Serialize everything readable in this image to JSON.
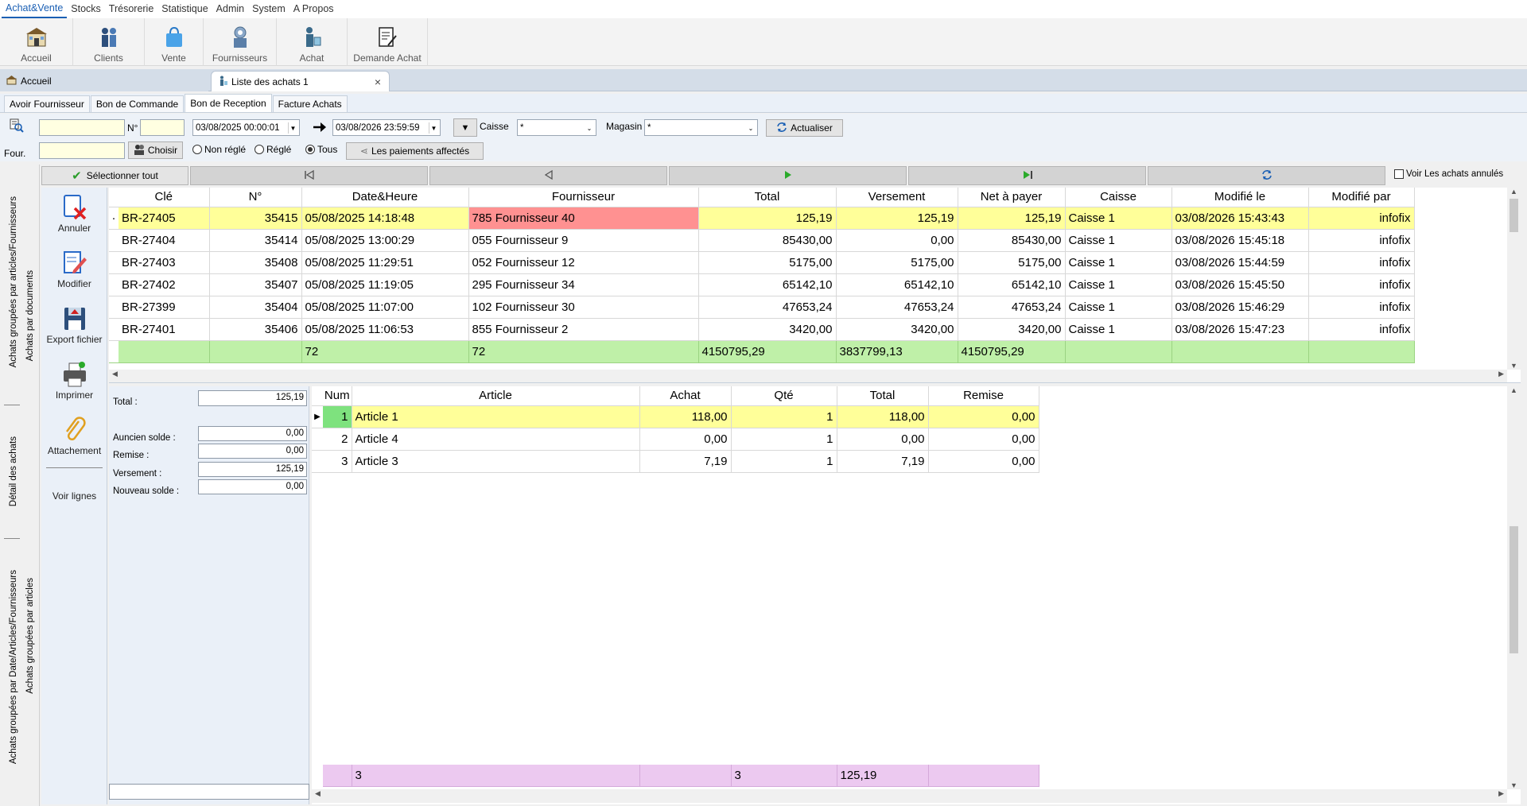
{
  "menu": [
    "Achat&Vente",
    "Stocks",
    "Trésorerie",
    "Statistique",
    "Admin",
    "System",
    "A Propos"
  ],
  "toolbar": [
    {
      "label": "Accueil",
      "icon": "home-icon"
    },
    {
      "label": "Clients",
      "icon": "clients-icon"
    },
    {
      "label": "Vente",
      "icon": "shopping-bag-icon"
    },
    {
      "label": "Fournisseurs",
      "icon": "suppliers-icon"
    },
    {
      "label": "Achat",
      "icon": "purchase-icon"
    },
    {
      "label": "Demande Achat",
      "icon": "request-icon"
    }
  ],
  "doc_tabs": {
    "home": "Accueil",
    "current": "Liste des achats 1",
    "close": "×"
  },
  "sub_tabs": [
    "Avoir Fournisseur",
    "Bon de Commande",
    "Bon de Reception",
    "Facture Achats"
  ],
  "filters": {
    "num_label": "N°",
    "date_from": "03/08/2025   00:00:01",
    "date_to": "03/08/2026   23:59:59",
    "caisse_label": "Caisse",
    "caisse_value": "*",
    "magasin_label": "Magasin",
    "magasin_value": "*",
    "refresh": "Actualiser",
    "four_label": "Four.",
    "choose": "Choisir",
    "radio_unpaid": "Non réglé",
    "radio_paid": "Réglé",
    "radio_all": "Tous",
    "payments": "Les paiements affectés"
  },
  "vertical_tabs": [
    "Achats groupées par articles/Fournisseurs",
    "Achats par documents",
    "Détail des achats",
    "Achats groupées par Date/Articles/Fournisseurs",
    "Achats groupées par articles"
  ],
  "nav": {
    "select_all": "Sélectionner tout",
    "show_cancelled": "Voir Les achats annulés"
  },
  "actions": [
    {
      "label": "Annuler",
      "icon": "cancel-document-icon"
    },
    {
      "label": "Modifier",
      "icon": "edit-document-icon"
    },
    {
      "label": "Export fichier",
      "icon": "export-file-icon"
    },
    {
      "label": "Imprimer",
      "icon": "printer-icon"
    },
    {
      "label": "Attachement",
      "icon": "paperclip-icon"
    },
    {
      "label": "Voir lignes",
      "icon": ""
    }
  ],
  "grid": {
    "columns": [
      "Clé",
      "N°",
      "Date&Heure",
      "Fournisseur",
      "Total",
      "Versement",
      "Net à payer",
      "Caisse",
      "Modifié le",
      "Modifié par"
    ],
    "rows": [
      [
        "BR-27405",
        "35415",
        "05/08/2025 14:18:48",
        "785 Fournisseur 40",
        "125,19",
        "125,19",
        "125,19",
        "Caisse 1",
        "03/08/2026 15:43:43",
        "infofix"
      ],
      [
        "BR-27404",
        "35414",
        "05/08/2025 13:00:29",
        "055 Fournisseur 9",
        "85430,00",
        "0,00",
        "85430,00",
        "Caisse 1",
        "03/08/2026 15:45:18",
        "infofix"
      ],
      [
        "BR-27403",
        "35408",
        "05/08/2025 11:29:51",
        "052 Fournisseur 12",
        "5175,00",
        "5175,00",
        "5175,00",
        "Caisse 1",
        "03/08/2026 15:44:59",
        "infofix"
      ],
      [
        "BR-27402",
        "35407",
        "05/08/2025 11:19:05",
        "295 Fournisseur 34",
        "65142,10",
        "65142,10",
        "65142,10",
        "Caisse 1",
        "03/08/2026 15:45:50",
        "infofix"
      ],
      [
        "BR-27399",
        "35404",
        "05/08/2025 11:07:00",
        "102 Fournisseur 30",
        "47653,24",
        "47653,24",
        "47653,24",
        "Caisse 1",
        "03/08/2026 15:46:29",
        "infofix"
      ],
      [
        "BR-27401",
        "35406",
        "05/08/2025 11:06:53",
        "855 Fournisseur 2",
        "3420,00",
        "3420,00",
        "3420,00",
        "Caisse 1",
        "03/08/2026 15:47:23",
        "infofix"
      ]
    ],
    "totals": [
      "",
      "",
      "72",
      "72",
      "4150795,29",
      "3837799,13",
      "4150795,29",
      "",
      "",
      ""
    ]
  },
  "summary": {
    "total_label": "Total :",
    "total": "125,19",
    "old_label": "Auncien solde :",
    "old": "0,00",
    "remise_label": "Remise :",
    "remise": "0,00",
    "versement_label": "Versement :",
    "versement": "125,19",
    "new_label": "Nouveau solde :",
    "new": "0,00"
  },
  "detail": {
    "columns": [
      "Num",
      "Article",
      "Achat",
      "Qté",
      "Total",
      "Remise"
    ],
    "rows": [
      [
        "1",
        "Article 1",
        "118,00",
        "1",
        "118,00",
        "0,00"
      ],
      [
        "2",
        "Article 4",
        "0,00",
        "1",
        "0,00",
        "0,00"
      ],
      [
        "3",
        "Article 3",
        "7,19",
        "1",
        "7,19",
        "0,00"
      ]
    ],
    "totals": [
      "",
      "3",
      "",
      "3",
      "125,19",
      ""
    ]
  }
}
